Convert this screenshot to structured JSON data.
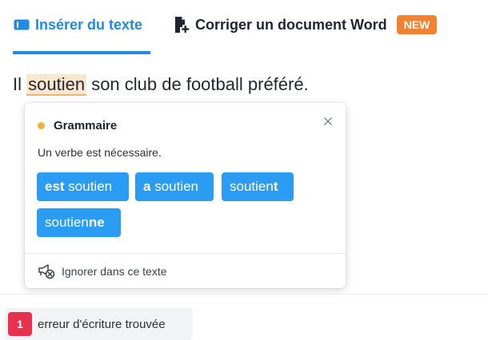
{
  "tabs": {
    "insert_label": "Insérer du texte",
    "correct_label": "Corriger un document Word",
    "new_badge": "NEW"
  },
  "text": {
    "before": "Il ",
    "flagged_word": "soutien",
    "after": " son club de football préféré."
  },
  "popover": {
    "category": "Grammaire",
    "message": "Un verbe est nécessaire.",
    "suggestions": [
      {
        "bold": "est",
        "rest": " soutien"
      },
      {
        "bold": "a",
        "rest": " soutien"
      },
      {
        "prefix": "soutien",
        "bold": "t"
      },
      {
        "prefix": "soutien",
        "bold": "ne"
      }
    ],
    "ignore_label": "Ignorer dans ce texte"
  },
  "summary": {
    "count": "1",
    "label": "erreur d'écriture trouvée"
  },
  "colors": {
    "accent": "#1f8ae8",
    "suggestion": "#2a9cf3",
    "new_badge": "#f2822f",
    "grammar_dot": "#f2b33d",
    "error_badge": "#e8304f"
  },
  "icons": {
    "insert_tab": "text-box-icon",
    "correct_tab": "document-add-icon",
    "close": "close-icon",
    "ignore": "megaphone-off-icon"
  }
}
